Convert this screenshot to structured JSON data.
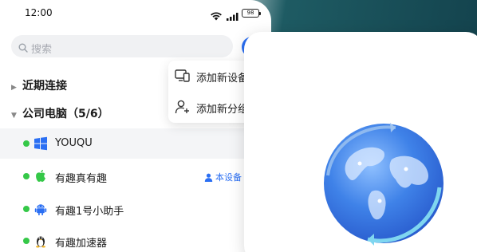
{
  "status_bar": {
    "time": "12:00",
    "battery": "98"
  },
  "search": {
    "placeholder": "搜索"
  },
  "sections": {
    "recent": {
      "label": "近期连接"
    },
    "company": {
      "label": "公司电脑（5/6）"
    }
  },
  "devices": [
    {
      "name": "YOUQU",
      "os": "windows-icon",
      "online": true,
      "selected": true
    },
    {
      "name": "有趣真有趣",
      "os": "apple-icon",
      "online": true,
      "badge": "本设备"
    },
    {
      "name": "有趣1号小助手",
      "os": "android-icon",
      "online": true
    },
    {
      "name": "有趣加速器",
      "os": "linux-icon",
      "online": true
    }
  ],
  "popup_menu": {
    "items": [
      {
        "label": "添加新设备",
        "icon": "devices-icon"
      },
      {
        "label": "添加新分组",
        "icon": "add-user-icon"
      }
    ]
  },
  "colors": {
    "accent": "#2b6ff3",
    "online": "#35c848",
    "background_dark": "#123f4a"
  }
}
